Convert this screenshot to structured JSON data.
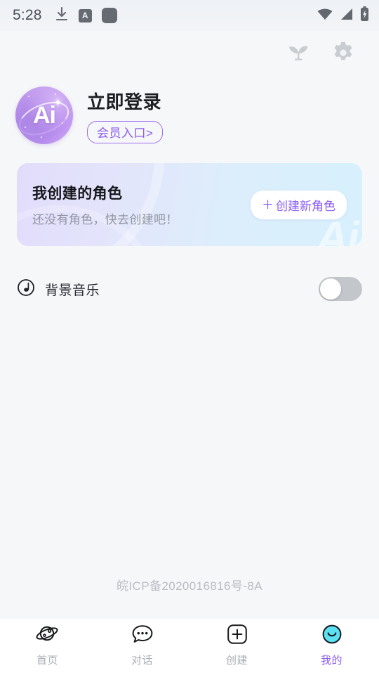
{
  "status_bar": {
    "time": "5:28",
    "left_icons": [
      "download-icon",
      "a-badge-icon",
      "app-square-icon"
    ],
    "a_badge_letter": "A",
    "right_icons": [
      "wifi-icon",
      "cellular-signal-icon",
      "battery-charging-icon"
    ]
  },
  "top_bar": {
    "icons": [
      "sprout-icon",
      "gear-icon"
    ]
  },
  "profile": {
    "avatar_text": "Ai",
    "login_label": "立即登录",
    "member_badge_label": "会员入口>"
  },
  "role_card": {
    "title": "我创建的角色",
    "subtitle": "还没有角色，快去创建吧！",
    "create_button_plus": "＋",
    "create_button_label": "创建新角色",
    "watermark_text": "Ai"
  },
  "settings": {
    "rows": [
      {
        "icon": "music-note-icon",
        "label": "背景音乐",
        "toggle_on": false
      }
    ]
  },
  "footer": {
    "icp": "皖ICP备2020016816号-8A"
  },
  "tabbar": {
    "items": [
      {
        "icon": "planet-icon",
        "label": "首页",
        "active": false
      },
      {
        "icon": "chat-bubble-icon",
        "label": "对话",
        "active": false
      },
      {
        "icon": "plus-square-icon",
        "label": "创建",
        "active": false
      },
      {
        "icon": "smiley-face-icon",
        "label": "我的",
        "active": true
      }
    ]
  },
  "colors": {
    "accent_purple": "#8a5cf0",
    "page_background": "#f6f7f9",
    "card_gradient_start": "#e2dcfb",
    "card_gradient_end": "#d7f0fd",
    "toggle_off_track": "#c3c6cb",
    "active_tab_icon_cyan": "#5ce1f2",
    "muted_text": "#9195a0"
  }
}
